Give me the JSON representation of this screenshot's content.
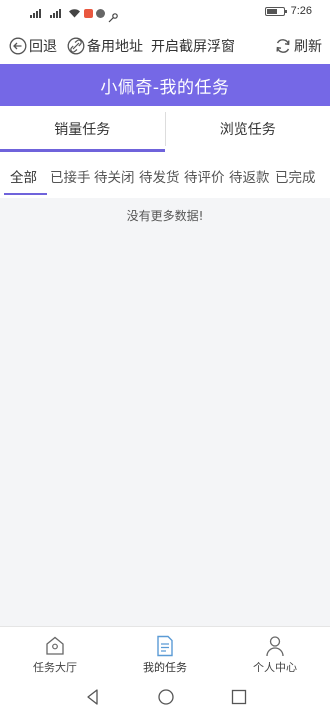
{
  "status_bar": {
    "signal_1_tag": "3G",
    "signal_2_tag": "3G",
    "time": "7:26",
    "battery_fraction": 0.6
  },
  "toolbar": {
    "back_label": "回退",
    "alt_address_label": "备用地址",
    "float_window_label": "开启截屏浮窗",
    "refresh_label": "刷新"
  },
  "header": {
    "title": "小佩奇-我的任务"
  },
  "main_tabs": [
    {
      "label": "销量任务",
      "active": true
    },
    {
      "label": "浏览任务",
      "active": false
    }
  ],
  "sub_tabs": [
    {
      "label": "全部",
      "active": true
    },
    {
      "label": "已接手",
      "active": false
    },
    {
      "label": "待关闭",
      "active": false
    },
    {
      "label": "待发货",
      "active": false
    },
    {
      "label": "待评价",
      "active": false
    },
    {
      "label": "待返款",
      "active": false
    },
    {
      "label": "已完成",
      "active": false
    }
  ],
  "content": {
    "empty_message": "没有更多数据!"
  },
  "bottom_nav": [
    {
      "label": "任务大厅",
      "icon": "home-icon",
      "active": false
    },
    {
      "label": "我的任务",
      "icon": "document-icon",
      "active": true
    },
    {
      "label": "个人中心",
      "icon": "user-icon",
      "active": false
    }
  ],
  "colors": {
    "accent": "#7568e6",
    "underline": "#6f63db",
    "content_bg": "#f4f5f7",
    "active_nav_icon": "#5b9bd5"
  }
}
